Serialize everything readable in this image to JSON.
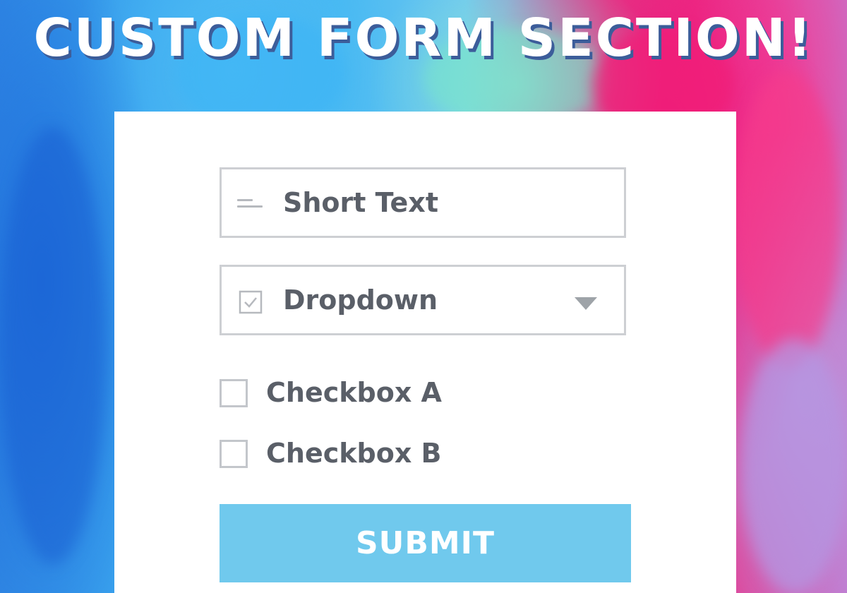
{
  "page": {
    "headline": "CUSTOM FORM SECTION!"
  },
  "form": {
    "short_text": {
      "value": "Short Text",
      "icon": "short-text-icon"
    },
    "dropdown": {
      "selected": "Dropdown",
      "icon": "checkbox-icon",
      "caret_icon": "caret-down-icon"
    },
    "checkboxes": [
      {
        "label": "Checkbox A",
        "checked": false
      },
      {
        "label": "Checkbox B",
        "checked": false
      }
    ],
    "submit_label": "SUBMIT"
  },
  "colors": {
    "headline_shadow": "#3c5d9a",
    "field_border": "#cdcfd3",
    "text": "#5a5f68",
    "submit_background": "#70c9ed",
    "submit_text": "#ffffff",
    "card_background": "#ffffff"
  }
}
